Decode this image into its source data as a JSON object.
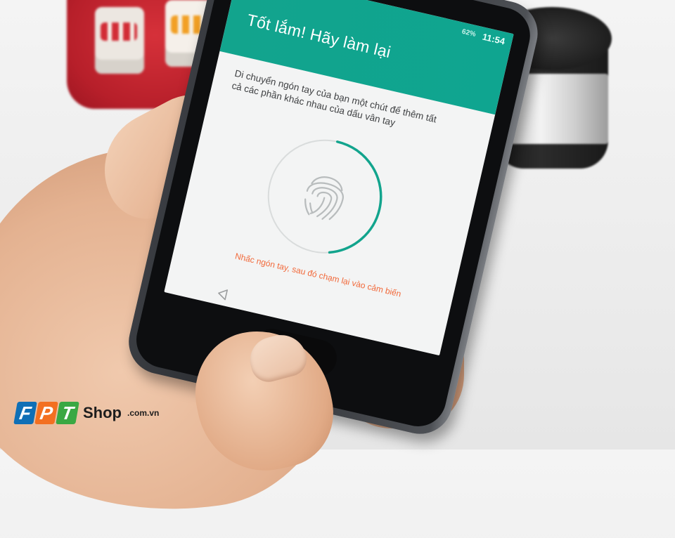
{
  "screen": {
    "status_bar": {
      "battery": "62%",
      "time": "11:54"
    },
    "title": "Tốt lắm! Hãy làm lại",
    "instructions": "Di chuyển ngón tay của bạn một chút để thêm tất cả các phần khác nhau của dấu vân tay",
    "progress": 0.45,
    "hint": "Nhấc ngón tay, sau đó chạm lại vào cảm biến",
    "accent_color": "#12a48d",
    "hint_color": "#f2693a",
    "icons": {
      "fingerprint": "fingerprint-icon",
      "back": "back-triangle-icon"
    }
  },
  "watermark": {
    "letters": [
      "F",
      "P",
      "T"
    ],
    "shop": "Shop",
    "domain": ".com.vn"
  }
}
